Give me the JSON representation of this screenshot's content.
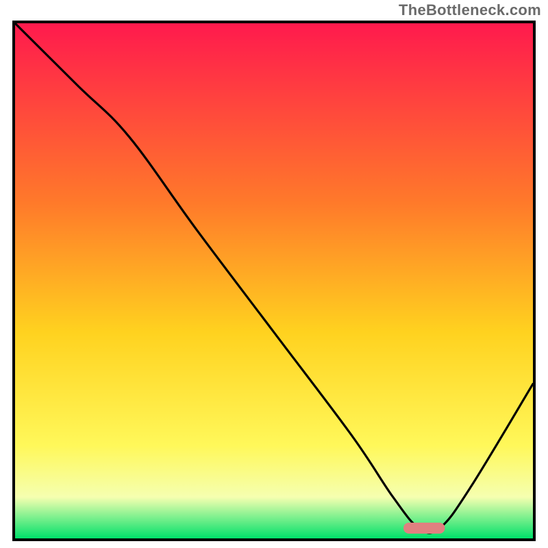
{
  "watermark": "TheBottleneck.com",
  "colors": {
    "gradient": [
      {
        "offset": 0,
        "hex": "#ff1a4d"
      },
      {
        "offset": 35,
        "hex": "#ff7a2a"
      },
      {
        "offset": 60,
        "hex": "#ffd21f"
      },
      {
        "offset": 82,
        "hex": "#fff85a"
      },
      {
        "offset": 92,
        "hex": "#f5ffb0"
      },
      {
        "offset": 100,
        "hex": "#00e06a"
      }
    ],
    "curve": "#000000",
    "marker": "#e08080",
    "frame": "#000000"
  },
  "chart_data": {
    "type": "line",
    "title": "",
    "xlabel": "",
    "ylabel": "",
    "xlim": [
      0,
      100
    ],
    "ylim": [
      0,
      100
    ],
    "x": [
      0,
      12,
      22,
      35,
      50,
      65,
      73,
      78,
      82,
      88,
      100
    ],
    "values": [
      100,
      88,
      78,
      60,
      40,
      20,
      8,
      2,
      2,
      10,
      30
    ],
    "marker": {
      "x_start": 75,
      "x_end": 83,
      "y": 2
    },
    "annotations": []
  }
}
